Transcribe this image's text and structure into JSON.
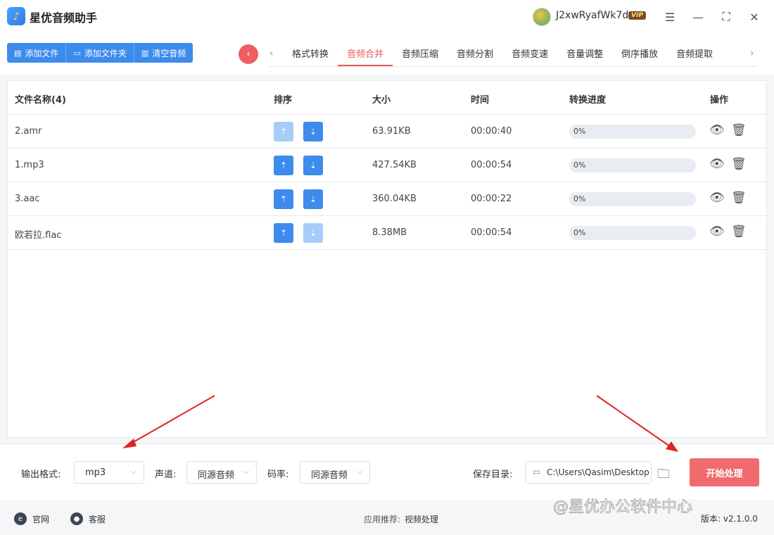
{
  "app": {
    "title": "星优音频助手",
    "logo_icon": "music-note-icon"
  },
  "user": {
    "name": "J2xwRyafWk7d",
    "badge": "VIP"
  },
  "window_controls": [
    "settings-icon",
    "minimize-icon",
    "maximize-icon",
    "close-icon"
  ],
  "toolbar": {
    "add_file": "添加文件",
    "add_folder": "添加文件夹",
    "clear_audio": "清空音频"
  },
  "tabs": [
    {
      "label": "格式转换",
      "active": false
    },
    {
      "label": "音频合并",
      "active": true
    },
    {
      "label": "音频压缩",
      "active": false
    },
    {
      "label": "音频分割",
      "active": false
    },
    {
      "label": "音频变速",
      "active": false
    },
    {
      "label": "音量调整",
      "active": false
    },
    {
      "label": "倒序播放",
      "active": false
    },
    {
      "label": "音频提取",
      "active": false
    }
  ],
  "table": {
    "headers": {
      "name": "文件名称(4)",
      "sort": "排序",
      "size": "大小",
      "time": "时间",
      "progress": "转换进度",
      "actions": "操作"
    },
    "rows": [
      {
        "name": "2.amr",
        "size": "63.91KB",
        "time": "00:00:40",
        "progress": "0%",
        "progress_value": 0,
        "up_enabled": false,
        "down_enabled": true
      },
      {
        "name": "1.mp3",
        "size": "427.54KB",
        "time": "00:00:54",
        "progress": "0%",
        "progress_value": 0,
        "up_enabled": true,
        "down_enabled": true
      },
      {
        "name": "3.aac",
        "size": "360.04KB",
        "time": "00:00:22",
        "progress": "0%",
        "progress_value": 0,
        "up_enabled": true,
        "down_enabled": true
      },
      {
        "name": "欧若拉.flac",
        "size": "8.38MB",
        "time": "00:00:54",
        "progress": "0%",
        "progress_value": 0,
        "up_enabled": true,
        "down_enabled": false
      }
    ]
  },
  "settings": {
    "format_label": "输出格式:",
    "format_value": "mp3",
    "channel_label": "声道:",
    "channel_value": "同源音频",
    "bitrate_label": "码率:",
    "bitrate_value": "同源音频",
    "save_label": "保存目录:",
    "save_path": "C:\\Users\\Qasim\\Desktop",
    "start_label": "开始处理"
  },
  "footer": {
    "website": "官网",
    "support": "客服",
    "recommend_label": "应用推荐:",
    "recommend_link": "视频处理",
    "version": "版本: v2.1.0.0"
  },
  "watermark": "@星优办公软件中心",
  "colors": {
    "accent_blue": "#3d8bec",
    "accent_red": "#e8595c",
    "arrow_red": "#e02424"
  }
}
